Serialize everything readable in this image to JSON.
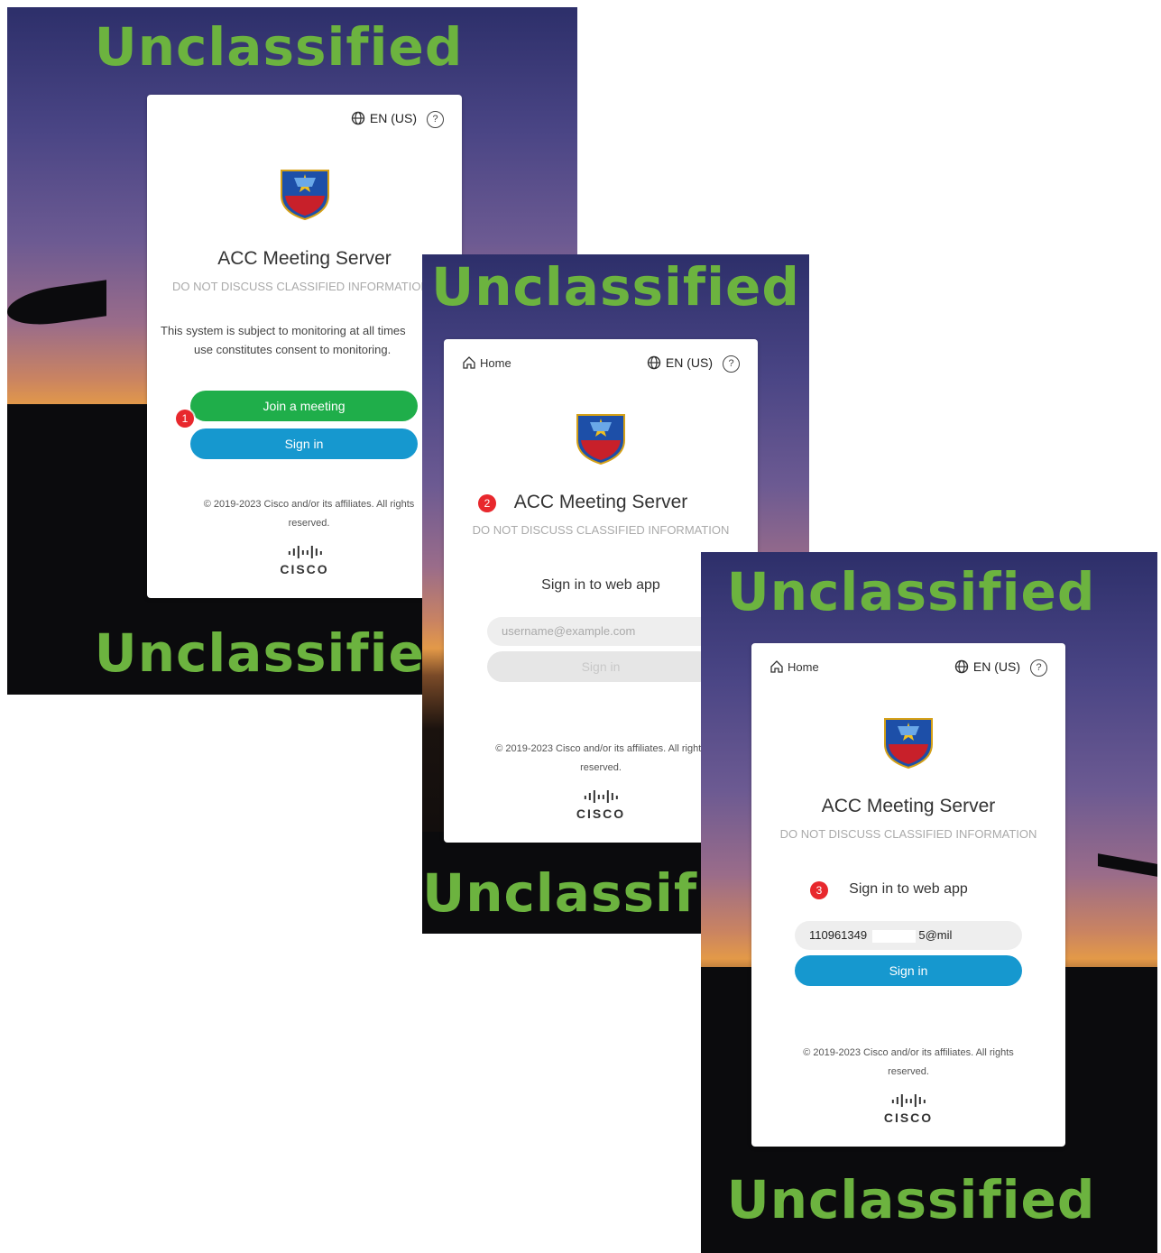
{
  "banner_text": "Unclassified",
  "lang": "EN (US)",
  "help_symbol": "?",
  "home_label": "Home",
  "app_title": "ACC Meeting Server",
  "warning": "DO NOT DISCUSS CLASSIFIED INFORMATION",
  "screen1": {
    "step": "1",
    "body_line1": "This system is subject to monitoring at all times",
    "body_line2": "use constitutes consent to monitoring.",
    "join_label": "Join a meeting",
    "signin_label": "Sign in"
  },
  "screen2": {
    "step": "2",
    "subhead": "Sign in to web app",
    "input_placeholder": "username@example.com",
    "signin_label": "Sign in"
  },
  "screen3": {
    "step": "3",
    "subhead": "Sign in to web app",
    "input_value_start": "110961349",
    "input_value_end": "5@mil",
    "signin_label": "Sign in"
  },
  "copyright_line1": "© 2019-2023 Cisco and/or its affiliates. All rights",
  "copyright_line2": "reserved.",
  "cisco_word": "CISCO",
  "colors": {
    "banner": "#6cb33f",
    "join_green": "#1fae4a",
    "signin_blue": "#1698cf",
    "step_red": "#e8282d"
  },
  "icons": [
    "globe-icon",
    "help-icon",
    "home-icon",
    "crest-logo",
    "cisco-logo"
  ]
}
